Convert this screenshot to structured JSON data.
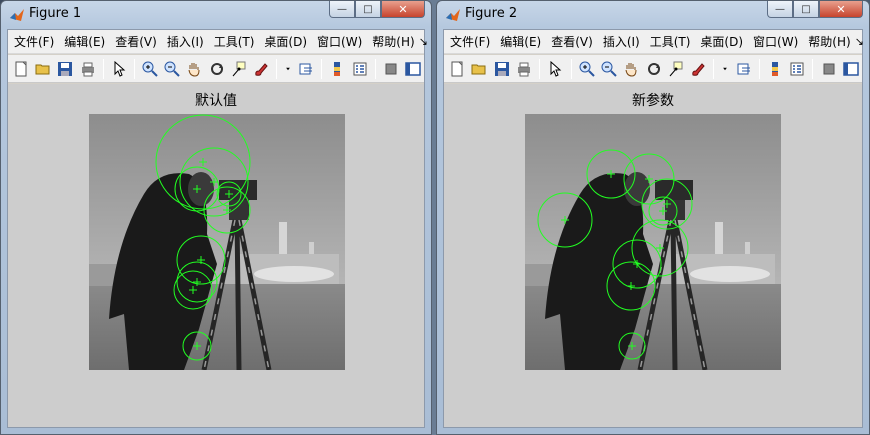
{
  "figures": [
    {
      "title": "Figure 1",
      "axes_title": "默认值",
      "menu": [
        "文件(F)",
        "编辑(E)",
        "查看(V)",
        "插入(I)",
        "工具(T)",
        "桌面(D)",
        "窗口(W)",
        "帮助(H)"
      ],
      "menu_more": "↘"
    },
    {
      "title": "Figure 2",
      "axes_title": "新参数",
      "menu": [
        "文件(F)",
        "编辑(E)",
        "查看(V)",
        "插入(I)",
        "工具(T)",
        "桌面(D)",
        "窗口(W)",
        "帮助(H)"
      ],
      "menu_more": "↘"
    }
  ],
  "window_controls": {
    "minimize": "—",
    "maximize": "□",
    "close": "✕"
  },
  "toolbar_icons": [
    "new-figure-icon",
    "open-file-icon",
    "save-icon",
    "print-icon",
    "pointer-icon",
    "zoom-in-icon",
    "zoom-out-icon",
    "pan-hand-icon",
    "rotate-3d-icon",
    "data-cursor-icon",
    "brush-icon",
    "brush-dropdown-icon",
    "link-plot-icon",
    "colorbar-icon",
    "legend-icon",
    "hide-plot-tools-icon",
    "show-plot-tools-icon"
  ],
  "colors": {
    "marker": "#22ff22",
    "canvas": "#cdcdcd",
    "menubar": "#f0f0f0"
  }
}
